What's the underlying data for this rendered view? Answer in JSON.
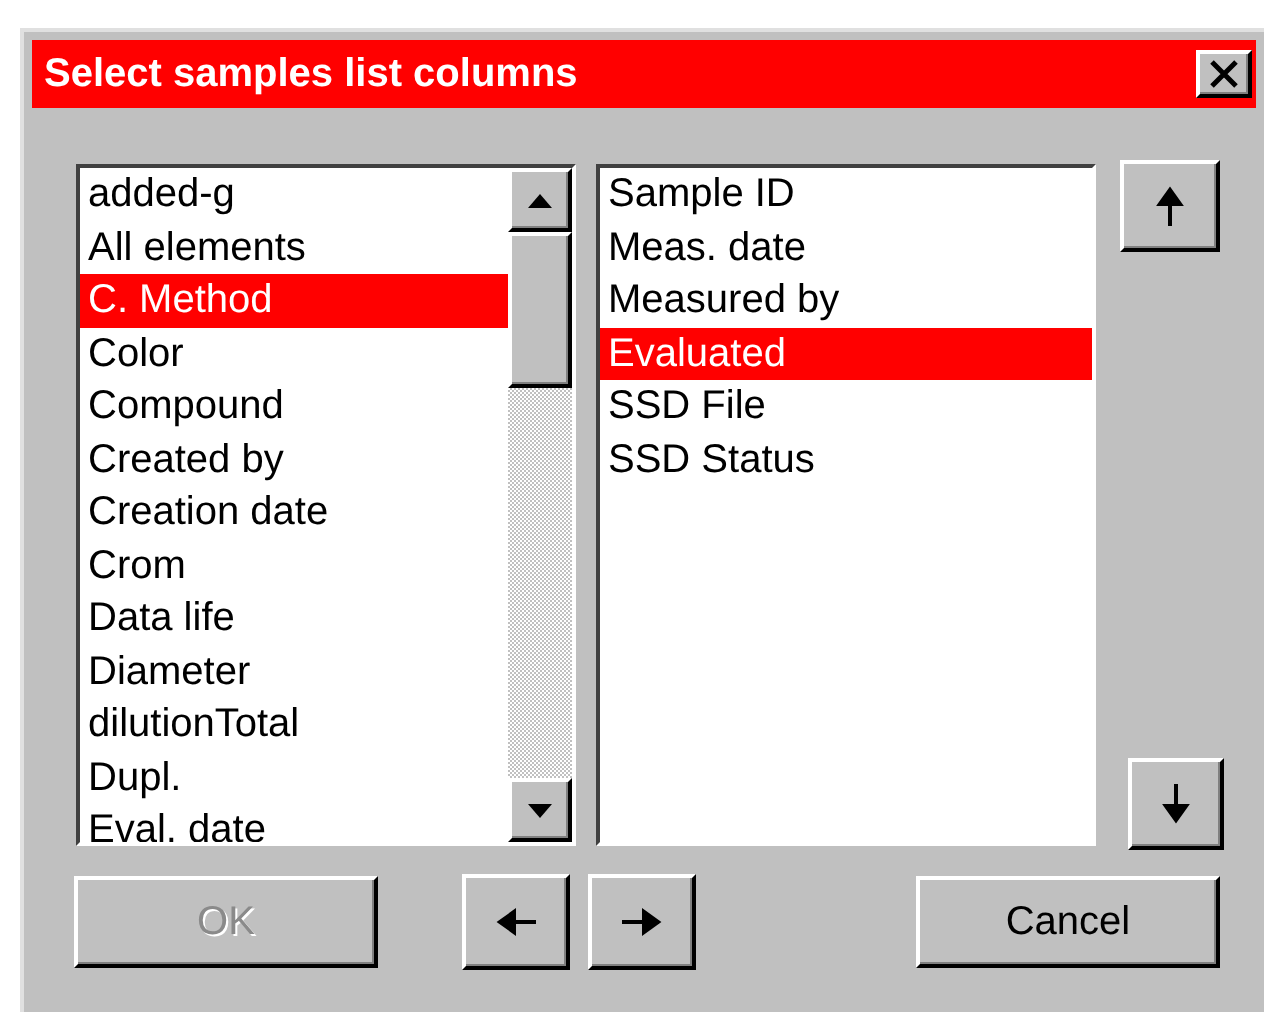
{
  "window": {
    "title": "Select samples list columns"
  },
  "available_list": {
    "items": [
      {
        "label": "added-g",
        "selected": false
      },
      {
        "label": "All elements",
        "selected": false
      },
      {
        "label": "C. Method",
        "selected": true
      },
      {
        "label": "Color",
        "selected": false
      },
      {
        "label": "Compound",
        "selected": false
      },
      {
        "label": "Created by",
        "selected": false
      },
      {
        "label": "Creation date",
        "selected": false
      },
      {
        "label": "Crom",
        "selected": false
      },
      {
        "label": "Data life",
        "selected": false
      },
      {
        "label": "Diameter",
        "selected": false
      },
      {
        "label": "dilutionTotal",
        "selected": false
      },
      {
        "label": "Dupl.",
        "selected": false
      },
      {
        "label": "Eval. date",
        "selected": false
      }
    ]
  },
  "selected_list": {
    "items": [
      {
        "label": "Sample ID",
        "selected": false
      },
      {
        "label": "Meas. date",
        "selected": false
      },
      {
        "label": "Measured by",
        "selected": false
      },
      {
        "label": "Evaluated",
        "selected": true
      },
      {
        "label": "SSD File",
        "selected": false
      },
      {
        "label": "SSD Status",
        "selected": false
      }
    ]
  },
  "buttons": [
    {
      "label": "OK",
      "disabled": true
    },
    {
      "label": "Cancel",
      "disabled": false
    }
  ]
}
